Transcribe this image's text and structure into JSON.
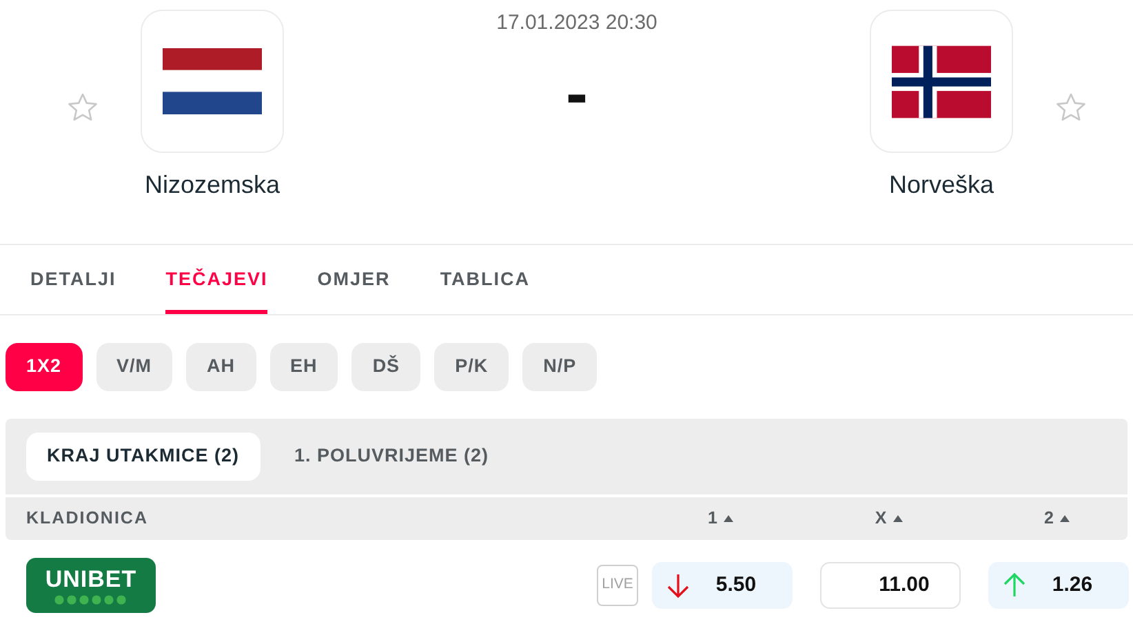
{
  "match": {
    "datetime": "17.01.2023 20:30",
    "score": "-",
    "home": {
      "name": "Nizozemska",
      "kind": "tricolor",
      "favorite": false
    },
    "away": {
      "name": "Norveška",
      "kind": "cross",
      "favorite": false
    }
  },
  "tabs": [
    {
      "label": "DETALJI",
      "selected": false
    },
    {
      "label": "TEČAJEVI",
      "selected": true
    },
    {
      "label": "OMJER",
      "selected": false
    },
    {
      "label": "TABLICA",
      "selected": false
    }
  ],
  "markets": [
    {
      "label": "1X2",
      "selected": true
    },
    {
      "label": "V/M",
      "selected": false
    },
    {
      "label": "AH",
      "selected": false
    },
    {
      "label": "EH",
      "selected": false
    },
    {
      "label": "DŠ",
      "selected": false
    },
    {
      "label": "P/K",
      "selected": false
    },
    {
      "label": "N/P",
      "selected": false
    }
  ],
  "periods": [
    {
      "label": "KRAJ UTAKMICE (2)",
      "selected": true
    },
    {
      "label": "1. POLUVRIJEME (2)",
      "selected": false
    }
  ],
  "table": {
    "columns": [
      "KLADIONICA",
      "1",
      "X",
      "2"
    ],
    "rows": [
      {
        "bookmaker": "UNIBET",
        "live": "LIVE",
        "odds": [
          {
            "value": "5.50",
            "kind": "down"
          },
          {
            "value": "11.00",
            "kind": "flat"
          },
          {
            "value": "1.26",
            "kind": "up"
          }
        ]
      }
    ]
  }
}
